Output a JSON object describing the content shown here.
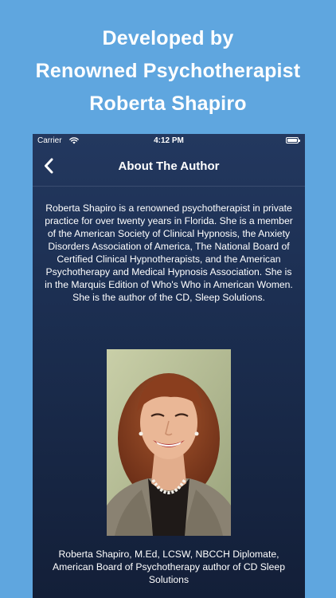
{
  "headline": {
    "line1": "Developed by",
    "line2": "Renowned Psychotherapist",
    "line3": "Roberta Shapiro"
  },
  "status_bar": {
    "carrier": "Carrier",
    "time": "4:12 PM",
    "icons": [
      "wifi-icon",
      "battery-icon"
    ]
  },
  "nav": {
    "back_icon": "chevron-left-icon",
    "title": "About The Author"
  },
  "bio": "Roberta Shapiro is a renowned psychotherapist in private practice for over twenty years in Florida. She is a member of the American Society of Clinical Hypnosis, the Anxiety Disorders Association of America, The National Board of Certified Clinical Hypnotherapists, and the American Psychotherapy and Medical Hypnosis Association. She is in the Marquis Edition of Who's Who in American Women. She is the author of the CD, Sleep Solutions.",
  "caption": "Roberta Shapiro, M.Ed, LCSW, NBCCH Diplomate, American Board of Psychotherapy author of CD Sleep Solutions",
  "colors": {
    "page_background": "#5fa6df",
    "screen_top": "#23385f",
    "screen_bottom": "#131f38",
    "text": "#ffffff"
  }
}
